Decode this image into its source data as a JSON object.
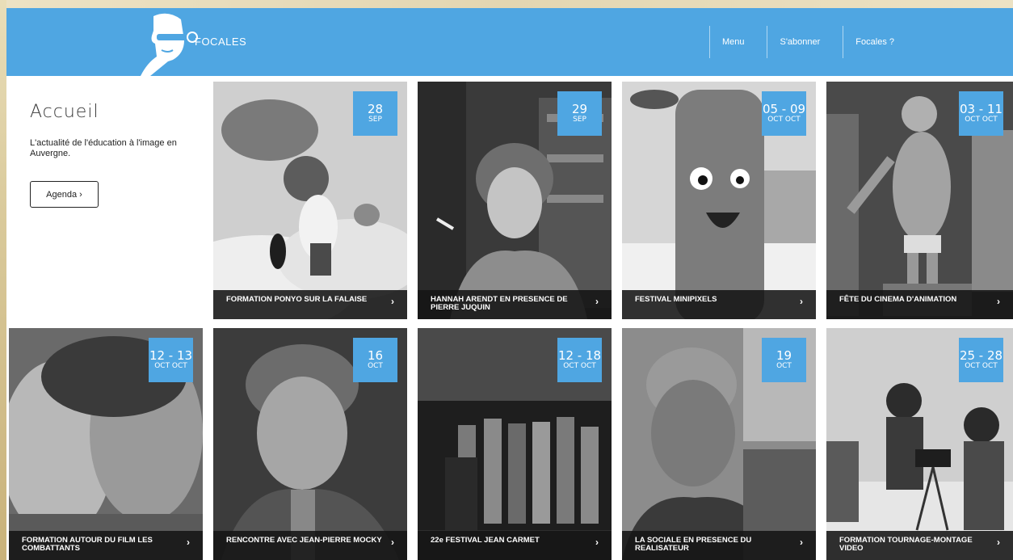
{
  "header": {
    "brand": "FOCALES",
    "nav": [
      "Menu",
      "S'abonner",
      "Focales ?"
    ]
  },
  "intro": {
    "title": "Accueil",
    "subtitle": "L'actualité de l'éducation à l'image en Auvergne.",
    "agenda_label": "Agenda ›"
  },
  "tiles": [
    {
      "day": "28",
      "month": "SEP",
      "title": "FORMATION PONYO SUR LA FALAISE",
      "chevron": "›"
    },
    {
      "day": "29",
      "month": "SEP",
      "title": "HANNAH ARENDT EN PRESENCE DE PIERRE JUQUIN",
      "chevron": "›"
    },
    {
      "day": "05 - 09",
      "month": "OCT  OCT",
      "title": "FESTIVAL MINIPIXELS",
      "chevron": "›"
    },
    {
      "day": "03 - 11",
      "month": "OCT  OCT",
      "title": "FÊTE DU CINEMA D'ANIMATION",
      "chevron": "›"
    },
    {
      "day": "12 - 13",
      "month": "OCT  OCT",
      "title": "FORMATION AUTOUR DU FILM LES COMBATTANTS",
      "chevron": "›"
    },
    {
      "day": "16",
      "month": "OCT",
      "title": "RENCONTRE AVEC JEAN-PIERRE MOCKY",
      "chevron": "›"
    },
    {
      "day": "12 - 18",
      "month": "OCT  OCT",
      "title": "22e FESTIVAL JEAN CARMET",
      "chevron": "›"
    },
    {
      "day": "19",
      "month": "OCT",
      "title": "LA SOCIALE EN PRESENCE DU REALISATEUR",
      "chevron": "›"
    },
    {
      "day": "25 - 28",
      "month": "OCT  OCT",
      "title": "FORMATION TOURNAGE-MONTAGE VIDEO",
      "chevron": "›"
    }
  ],
  "colors": {
    "accent": "#4fa6e2",
    "caption_bg": "#141414",
    "frame": "#e8dcbf"
  },
  "icons": [
    "focales-logo-icon",
    "chevron-right-icon"
  ]
}
